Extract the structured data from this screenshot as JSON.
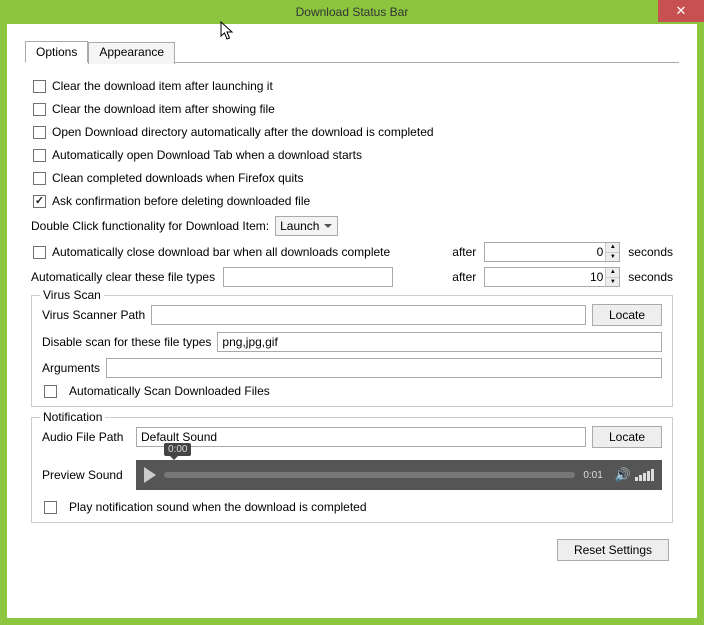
{
  "window": {
    "title": "Download Status Bar"
  },
  "tabs": {
    "options": "Options",
    "appearance": "Appearance"
  },
  "options": {
    "clear_after_launch": "Clear the download item after launching it",
    "clear_after_show": "Clear the download item after showing file",
    "open_dir_after": "Open Download directory automatically after the download is completed",
    "auto_open_tab": "Automatically open Download Tab when a download starts",
    "clean_on_quit": "Clean completed downloads when Firefox quits",
    "ask_confirm_delete": "Ask confirmation before deleting downloaded file",
    "dblclick_label": "Double Click functionality for Download Item:",
    "dblclick_value": "Launch",
    "auto_close_label": "Automatically close download bar when all downloads complete",
    "after_label": "after",
    "seconds_label": "seconds",
    "auto_close_value": "0",
    "auto_clear_types_label": "Automatically clear these file types",
    "auto_clear_types_value": "",
    "auto_clear_seconds": "10"
  },
  "virus": {
    "legend": "Virus Scan",
    "path_label": "Virus Scanner Path",
    "path_value": "",
    "locate": "Locate",
    "disable_types_label": "Disable scan for these file types",
    "disable_types_value": "png,jpg,gif",
    "arguments_label": "Arguments",
    "arguments_value": "",
    "auto_scan": "Automatically Scan Downloaded Files"
  },
  "notification": {
    "legend": "Notification",
    "audio_path_label": "Audio File Path",
    "audio_path_value": "Default Sound",
    "locate": "Locate",
    "preview_label": "Preview Sound",
    "tooltip_time": "0:00",
    "duration": "0:01",
    "play_sound": "Play notification sound when the download is completed"
  },
  "footer": {
    "reset": "Reset Settings"
  }
}
